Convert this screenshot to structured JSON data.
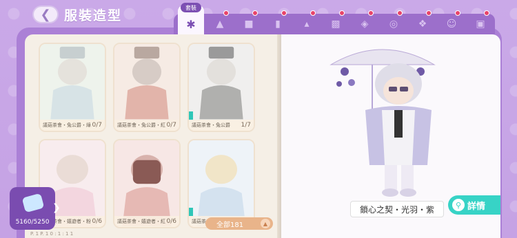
{
  "header": {
    "back_icon": "chevron-left-icon",
    "title": "服裝造型"
  },
  "tabs": {
    "active_label": "套裝",
    "items": [
      {
        "icon": "outfit-set-icon",
        "active": true
      },
      {
        "icon": "hat-icon",
        "dot": true
      },
      {
        "icon": "top-icon",
        "dot": true
      },
      {
        "icon": "bottom-icon",
        "dot": true
      },
      {
        "icon": "dress-icon",
        "dot": true
      },
      {
        "icon": "socks-icon",
        "dot": true
      },
      {
        "icon": "shoes-icon",
        "dot": true
      },
      {
        "icon": "glasses-icon",
        "dot": true
      },
      {
        "icon": "feather-icon",
        "dot": true
      },
      {
        "icon": "face-icon",
        "dot": true
      },
      {
        "icon": "shirt-icon",
        "dot": true
      }
    ]
  },
  "cards": [
    {
      "name": "議菇茶會・兔公爵・綠",
      "count": "0/7",
      "theme": "#eaf1e9"
    },
    {
      "name": "議菇茶會・兔公爵・紅",
      "count": "0/7",
      "theme": "#f5e0da"
    },
    {
      "name": "議菇茶會・兔公爵",
      "count": "1/7",
      "theme": "#ececec",
      "owned": true
    },
    {
      "name": "議菇茶會・嬉遊者・粉",
      "count": "0/6",
      "theme": "#f7e6ea"
    },
    {
      "name": "議菇茶會・嬉遊者・紅",
      "count": "0/6",
      "theme": "#f6dede"
    },
    {
      "name": "議菇茶",
      "count": "",
      "theme": "#e6eef7",
      "owned": true
    }
  ],
  "collection": {
    "icon": "wardrobe-badge-icon",
    "count": "5160/5250"
  },
  "filter": {
    "label": "全部181"
  },
  "preview": {
    "outfit_name": "鎖心之契・光羽・紫",
    "detail_label": "詳情"
  },
  "bottom_text": "P. 1    P. 1    0 : 1 : 1 1"
}
